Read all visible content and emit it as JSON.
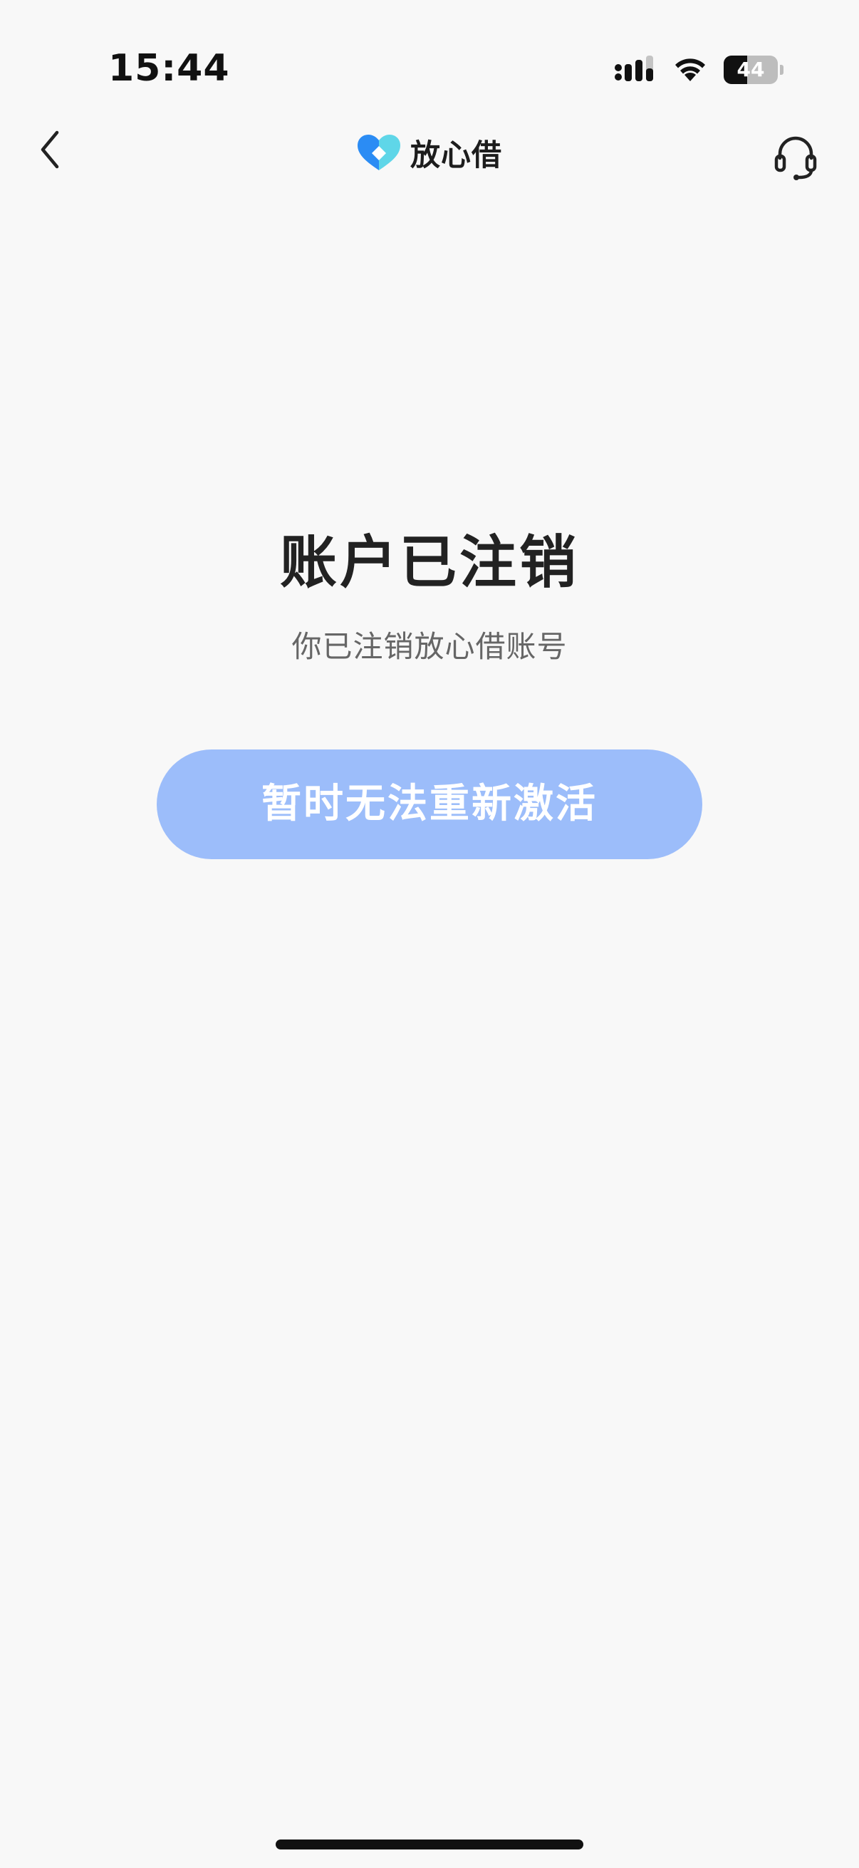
{
  "status_bar": {
    "time": "15:44",
    "battery_text": "44",
    "battery_level_percent": 44,
    "signal_icon": "cellular-signal-icon",
    "wifi_icon": "wifi-icon"
  },
  "nav": {
    "back_icon": "chevron-left-icon",
    "brand_logo_icon": "heart-diamond-logo-icon",
    "brand_name": "放心借",
    "support_icon": "headset-icon"
  },
  "main": {
    "title": "账户已注销",
    "subtitle": "你已注销放心借账号",
    "button_label": "暂时无法重新激活"
  },
  "colors": {
    "background": "#f8f8f8",
    "button_bg": "#9cbdfa",
    "title_color": "#222222",
    "subtitle_color": "#666666",
    "logo_blue": "#2b8cf4",
    "logo_cyan": "#5fd6e8"
  }
}
